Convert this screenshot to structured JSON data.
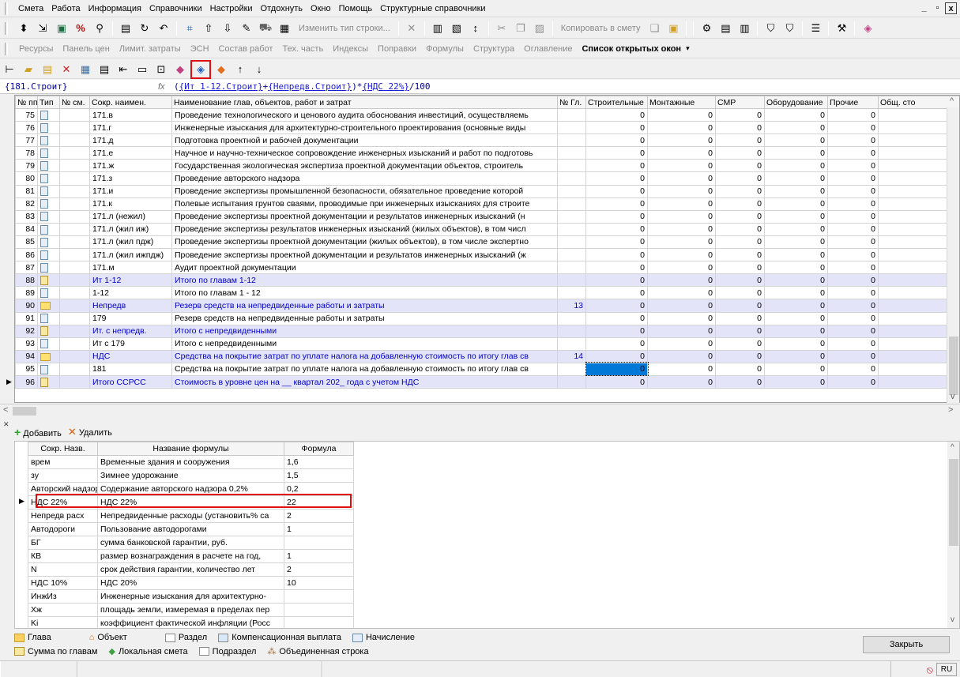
{
  "menu": [
    "Смета",
    "Работа",
    "Информация",
    "Справочники",
    "Настройки",
    "Отдохнуть",
    "Окно",
    "Помощь",
    "Структурные справочники"
  ],
  "window_controls": [
    "_",
    "▫",
    "x"
  ],
  "toolbar1": {
    "change_type_label": "Изменить тип строки...",
    "copy_to_estimate_label": "Копировать в смету"
  },
  "toolbar2": {
    "items": [
      "Ресурсы",
      "Панель цен",
      "Лимит. затраты",
      "ЭСН",
      "Состав работ",
      "Тех. часть",
      "Индексы",
      "Поправки",
      "Формулы",
      "Структура",
      "Оглавление"
    ],
    "active": "Список открытых окон"
  },
  "formula_bar": {
    "cell": "{181.Строит}",
    "fx": "fx",
    "part1": "(",
    "ref1": "{Ит 1-12.Строит}",
    "plus": "+",
    "ref2": "{Непредв.Строит}",
    "part2": ")*",
    "ref3": "{НДС 22%}",
    "part3": "/100"
  },
  "main_table": {
    "columns": [
      "№ пп",
      "Тип",
      "№ см.",
      "Сокр. наимен.",
      "Наименование глав, объектов, работ и затрат",
      "№ Гл.",
      "Строительные",
      "Монтажные",
      "СМР",
      "Оборудование",
      "Прочие",
      "Общ. сто"
    ],
    "rows": [
      {
        "n": "75",
        "code": "171.в",
        "name": "Проведение технологического и ценового аудита обоснования инвестиций, осуществляемь",
        "gl": "",
        "v": [
          "0",
          "0",
          "0",
          "0",
          "0"
        ],
        "hl": false,
        "type": "doc"
      },
      {
        "n": "76",
        "code": "171.г",
        "name": "Инженерные изыскания для архитектурно-строительного проектирования (основные виды",
        "gl": "",
        "v": [
          "0",
          "0",
          "0",
          "0",
          "0"
        ],
        "hl": false,
        "type": "doc"
      },
      {
        "n": "77",
        "code": "171.д",
        "name": "Подготовка проектной и рабочей документации",
        "gl": "",
        "v": [
          "0",
          "0",
          "0",
          "0",
          "0"
        ],
        "hl": false,
        "type": "doc"
      },
      {
        "n": "78",
        "code": "171.е",
        "name": "Научное и научно-техническое сопровождение инженерных изысканий и работ по подготовь",
        "gl": "",
        "v": [
          "0",
          "0",
          "0",
          "0",
          "0"
        ],
        "hl": false,
        "type": "doc"
      },
      {
        "n": "79",
        "code": "171.ж",
        "name": "Государственная экологическая экспертиза проектной документации объектов, строитель",
        "gl": "",
        "v": [
          "0",
          "0",
          "0",
          "0",
          "0"
        ],
        "hl": false,
        "type": "doc"
      },
      {
        "n": "80",
        "code": "171.з",
        "name": "Проведение авторского надзора",
        "gl": "",
        "v": [
          "0",
          "0",
          "0",
          "0",
          "0"
        ],
        "hl": false,
        "type": "doc"
      },
      {
        "n": "81",
        "code": "171.и",
        "name": "Проведение экспертизы промышленной безопасности, обязательное проведение которой",
        "gl": "",
        "v": [
          "0",
          "0",
          "0",
          "0",
          "0"
        ],
        "hl": false,
        "type": "doc"
      },
      {
        "n": "82",
        "code": "171.к",
        "name": "Полевые испытания грунтов сваями, проводимые при инженерных изысканиях для строите",
        "gl": "",
        "v": [
          "0",
          "0",
          "0",
          "0",
          "0"
        ],
        "hl": false,
        "type": "doc"
      },
      {
        "n": "83",
        "code": "171.л (нежил)",
        "name": "Проведение экспертизы проектной документации и результатов инженерных изысканий (н",
        "gl": "",
        "v": [
          "0",
          "0",
          "0",
          "0",
          "0"
        ],
        "hl": false,
        "type": "doc"
      },
      {
        "n": "84",
        "code": "171.л (жил иж)",
        "name": "Проведение экспертизы результатов инженерных изысканий (жилых объектов), в том числ",
        "gl": "",
        "v": [
          "0",
          "0",
          "0",
          "0",
          "0"
        ],
        "hl": false,
        "type": "doc"
      },
      {
        "n": "85",
        "code": "171.л (жил пдж)",
        "name": "Проведение экспертизы проектной документации (жилых объектов), в том числе экспертно",
        "gl": "",
        "v": [
          "0",
          "0",
          "0",
          "0",
          "0"
        ],
        "hl": false,
        "type": "doc"
      },
      {
        "n": "86",
        "code": "171.л (жил ижпдж)",
        "name": "Проведение экспертизы проектной документации и результатов инженерных изысканий (ж",
        "gl": "",
        "v": [
          "0",
          "0",
          "0",
          "0",
          "0"
        ],
        "hl": false,
        "type": "doc"
      },
      {
        "n": "87",
        "code": "171.м",
        "name": "Аудит проектной документации",
        "gl": "",
        "v": [
          "0",
          "0",
          "0",
          "0",
          "0"
        ],
        "hl": false,
        "type": "doc"
      },
      {
        "n": "88",
        "code": "Ит 1-12",
        "name": "Итого по главам 1-12",
        "gl": "",
        "v": [
          "0",
          "0",
          "0",
          "0",
          "0"
        ],
        "hl": true,
        "type": "sum"
      },
      {
        "n": "89",
        "code": "1-12",
        "name": "Итого по главам 1 - 12",
        "gl": "",
        "v": [
          "0",
          "0",
          "0",
          "0",
          "0"
        ],
        "hl": false,
        "type": "doc"
      },
      {
        "n": "90",
        "code": "Непредв",
        "name": "Резерв средств на непредвиденные работы и затраты",
        "gl": "13",
        "v": [
          "0",
          "0",
          "0",
          "0",
          "0"
        ],
        "hl": true,
        "type": "ch"
      },
      {
        "n": "91",
        "code": "179",
        "name": "Резерв средств на непредвиденные работы и затраты",
        "gl": "",
        "v": [
          "0",
          "0",
          "0",
          "0",
          "0"
        ],
        "hl": false,
        "type": "doc"
      },
      {
        "n": "92",
        "code": "Ит. с непредв.",
        "name": "Итого с непредвиденными",
        "gl": "",
        "v": [
          "0",
          "0",
          "0",
          "0",
          "0"
        ],
        "hl": true,
        "type": "sum"
      },
      {
        "n": "93",
        "code": "Ит с 179",
        "name": "Итого с непредвиденными",
        "gl": "",
        "v": [
          "0",
          "0",
          "0",
          "0",
          "0"
        ],
        "hl": false,
        "type": "doc"
      },
      {
        "n": "94",
        "code": "НДС",
        "name": "Средства на покрытие затрат по уплате налога на добавленную стоимость по итогу глав св",
        "gl": "14",
        "v": [
          "0",
          "0",
          "0",
          "0",
          "0"
        ],
        "hl": true,
        "type": "ch"
      },
      {
        "n": "95",
        "code": "181",
        "name": "Средства на покрытие затрат по уплате налога на добавленную стоимость по итогу глав св",
        "gl": "",
        "v": [
          "0",
          "0",
          "0",
          "0",
          "0"
        ],
        "hl": false,
        "type": "doc",
        "current": true
      },
      {
        "n": "96",
        "code": "Итого ССРСС",
        "name": "Стоимость в уровне цен на __ квартал 202_ года с учетом НДС",
        "gl": "",
        "v": [
          "0",
          "0",
          "0",
          "0",
          "0"
        ],
        "hl": true,
        "type": "sum"
      }
    ]
  },
  "formula_panel": {
    "add_label": "Добавить",
    "delete_label": "Удалить",
    "columns": [
      "Сокр. Назв.",
      "Название формулы",
      "Формула"
    ],
    "rows": [
      {
        "short": "врем",
        "name": "Временные здания и сооружения",
        "value": "1,6"
      },
      {
        "short": "зу",
        "name": "Зимнее удорожание",
        "value": "1,5"
      },
      {
        "short": "Авторский надзор",
        "name": "Содержание авторского надзора 0,2%",
        "value": "0,2"
      },
      {
        "short": "НДС 22%",
        "name": "НДС 22%",
        "value": "22",
        "current": true
      },
      {
        "short": "Непредв расх",
        "name": "Непредвиденные расходы (установить% са",
        "value": "2"
      },
      {
        "short": "Автодороги",
        "name": "Пользование автодорогами",
        "value": "1"
      },
      {
        "short": "БГ",
        "name": "сумма банковской гарантии, руб.",
        "value": ""
      },
      {
        "short": "КВ",
        "name": "размер вознаграждения в расчете на год,",
        "value": "1"
      },
      {
        "short": "N",
        "name": "срок действия гарантии, количество лет",
        "value": "2"
      },
      {
        "short": "НДС 10%",
        "name": "НДС 20%",
        "value": "10"
      },
      {
        "short": "ИнжИз",
        "name": "Инженерные изыскания для архитектурно-",
        "value": ""
      },
      {
        "short": "Хж",
        "name": "площадь земли, измеремая в пределах пер",
        "value": ""
      },
      {
        "short": "Ki",
        "name": "коэффициент фактической инфляции (Росс",
        "value": ""
      }
    ]
  },
  "legend": {
    "row1": [
      "Глава",
      "Объект",
      "Раздел",
      "Компенсационная выплата",
      "Начисление"
    ],
    "row2": [
      "Сумма по главам",
      "Локальная смета",
      "Подраздел",
      "Объединенная строка"
    ]
  },
  "close_label": "Закрыть",
  "lang": "RU"
}
